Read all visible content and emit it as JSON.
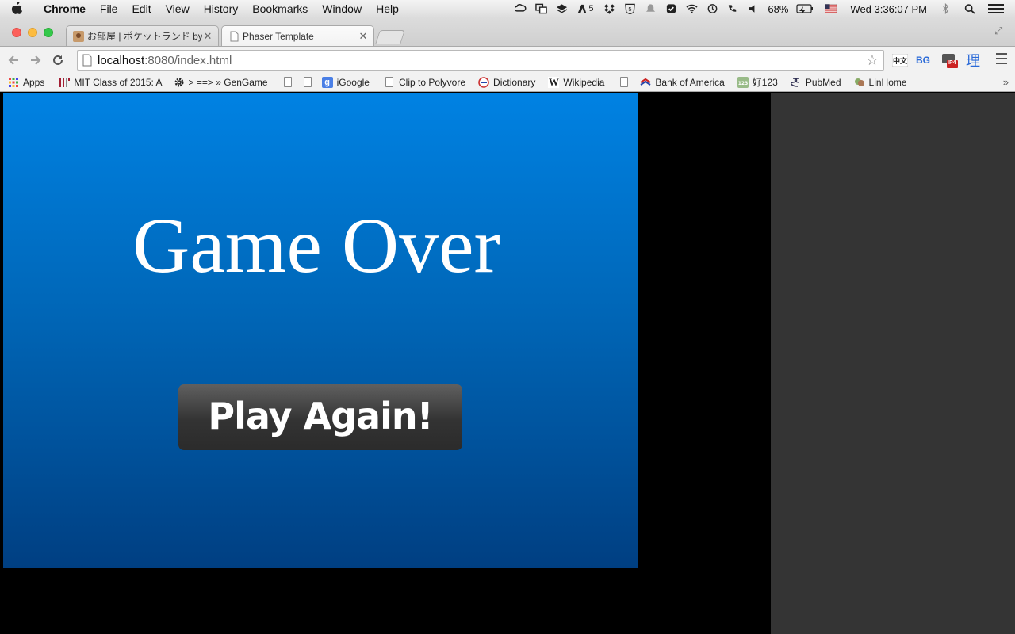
{
  "menubar": {
    "app_name": "Chrome",
    "menus": [
      "File",
      "Edit",
      "View",
      "History",
      "Bookmarks",
      "Window",
      "Help"
    ],
    "status": {
      "badge_count": "5",
      "battery": "68%",
      "clock": "Wed 3:36:07 PM"
    }
  },
  "browser": {
    "tabs": [
      {
        "title": "お部屋 | ポケットランド by…",
        "active": false
      },
      {
        "title": "Phaser Template",
        "active": true
      }
    ],
    "address": {
      "host": "localhost",
      "path": ":8080/index.html"
    },
    "extensions": {
      "bg_label": "BG",
      "ip4_label": "IP4",
      "ri_label": "理"
    },
    "bookmarks": [
      {
        "label": "Apps",
        "icon": "apps-grid-icon"
      },
      {
        "label": "MIT Class of 2015: A",
        "icon": "mit-icon"
      },
      {
        "label": "> ==> » GenGame",
        "icon": "gear-icon"
      },
      {
        "label": "",
        "icon": "page-icon"
      },
      {
        "label": "",
        "icon": "page-icon"
      },
      {
        "label": "iGoogle",
        "icon": "google-icon"
      },
      {
        "label": "Clip to Polyvore",
        "icon": "page-icon"
      },
      {
        "label": "Dictionary",
        "icon": "dictionary-icon"
      },
      {
        "label": "Wikipedia",
        "icon": "wikipedia-icon"
      },
      {
        "label": "",
        "icon": "page-icon"
      },
      {
        "label": "Bank of America",
        "icon": "bank-of-america-icon"
      },
      {
        "label": "好123",
        "icon": "hao123-icon"
      },
      {
        "label": "PubMed",
        "icon": "pubmed-icon"
      },
      {
        "label": "LinHome",
        "icon": "linhome-icon"
      }
    ],
    "bookmarks_overflow": "»"
  },
  "game": {
    "title": "Game Over",
    "button_label": "Play Again!",
    "colors": {
      "background_top": "#0082e3",
      "background_bottom": "#003f82",
      "button": "#3a3a3a",
      "side_panel": "#343434"
    }
  }
}
